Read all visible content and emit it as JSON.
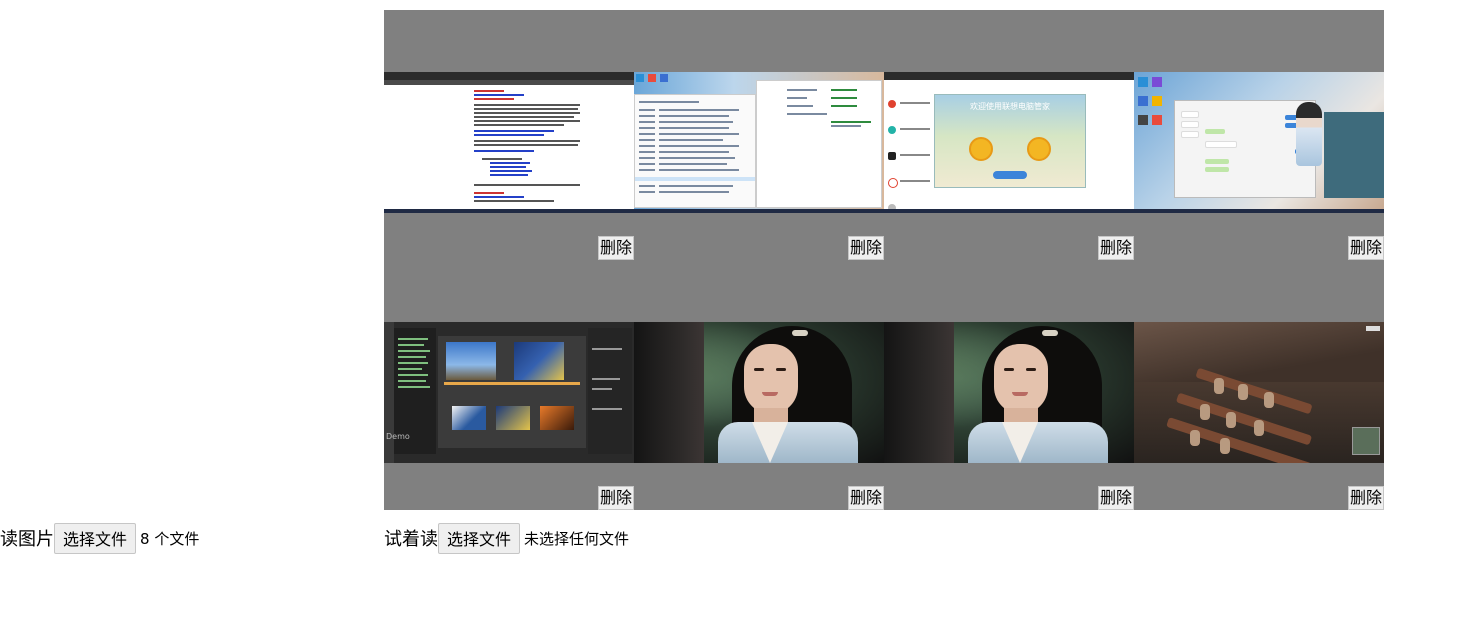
{
  "gallery": {
    "items": [
      {
        "label": "删除",
        "thumb": "browser-article-screenshot"
      },
      {
        "label": "删除",
        "thumb": "file-explorer-screenshot"
      },
      {
        "label": "删除",
        "thumb": "software-manager-popup-screenshot"
      },
      {
        "label": "删除",
        "thumb": "qq-chat-anime-desktop-screenshot"
      },
      {
        "label": "删除",
        "thumb": "dark-editor-screenshot"
      },
      {
        "label": "删除",
        "thumb": "drama-scene-still"
      },
      {
        "label": "删除",
        "thumb": "drama-scene-still"
      },
      {
        "label": "删除",
        "thumb": "game-cabin-screenshot"
      }
    ],
    "popup_title": "欢迎使用联想电脑管家",
    "editor_logo": "Demo"
  },
  "controls": {
    "read_label": "读图片",
    "read_button": "选择文件",
    "read_status": "8 个文件",
    "try_label": "试着读",
    "try_button": "选择文件",
    "try_status": "未选择任何文件"
  },
  "colors": {
    "gallery_bg": "#808080",
    "button_bg": "#efefef"
  }
}
